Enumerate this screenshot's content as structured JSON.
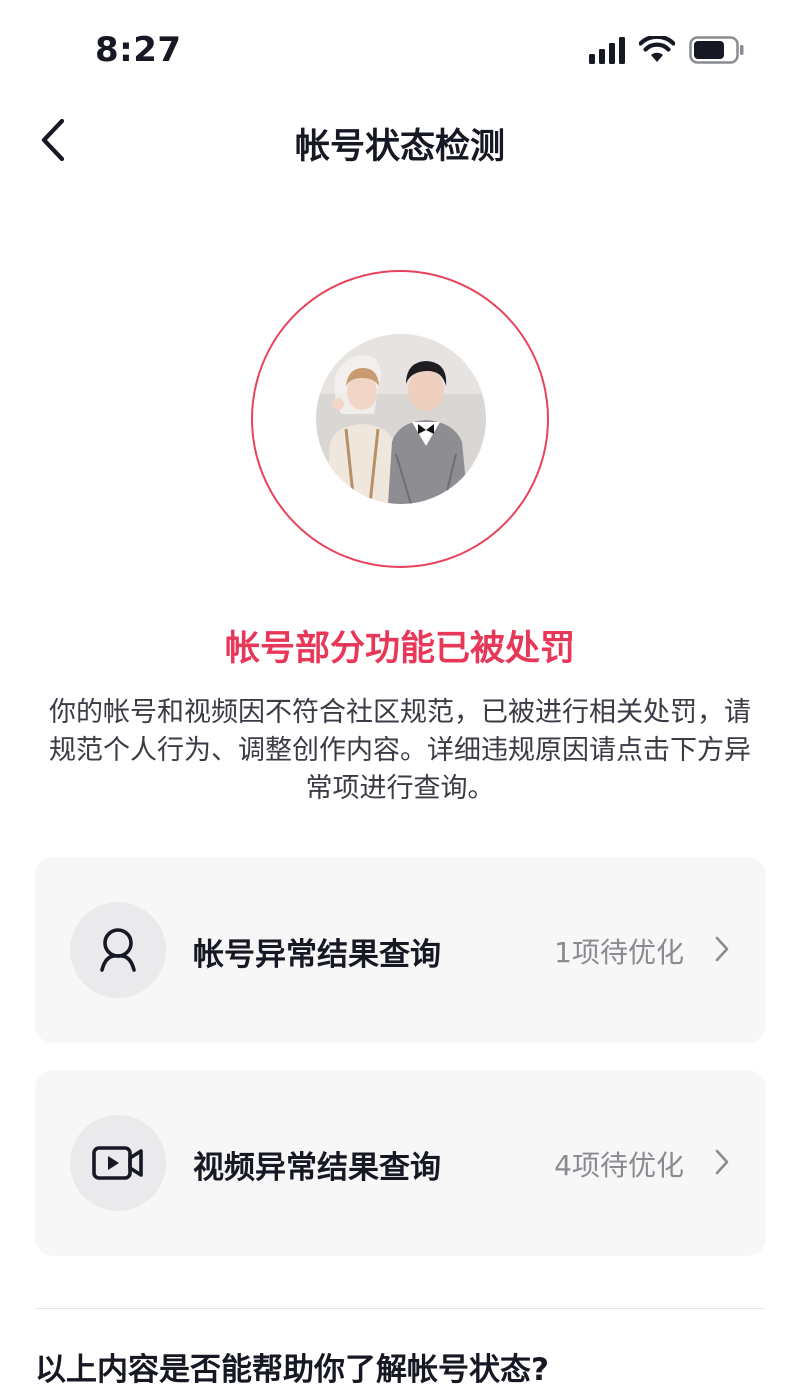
{
  "status_bar": {
    "time": "8:27",
    "icons": [
      "signal-icon",
      "wifi-icon",
      "battery-icon"
    ]
  },
  "nav": {
    "back_icon": "chevron-left-icon",
    "title": "帐号状态检测"
  },
  "profile": {
    "ring_color": "#e8425c"
  },
  "headline": "帐号部分功能已被处罚",
  "description": "你的帐号和视频因不符合社区规范，已被进行相关处罚，请规范个人行为、调整创作内容。详细违规原因请点击下方异常项进行查询。",
  "cards": [
    {
      "icon": "user-icon",
      "label": "帐号异常结果查询",
      "count": "1项待优化"
    },
    {
      "icon": "video-icon",
      "label": "视频异常结果查询",
      "count": "4项待优化"
    }
  ],
  "feedback": {
    "question": "以上内容是否能帮助你了解帐号状态?"
  },
  "colors": {
    "accent": "#e8385a",
    "card_bg": "#f7f7f8",
    "text": "#161823",
    "muted": "#8a8b91"
  }
}
